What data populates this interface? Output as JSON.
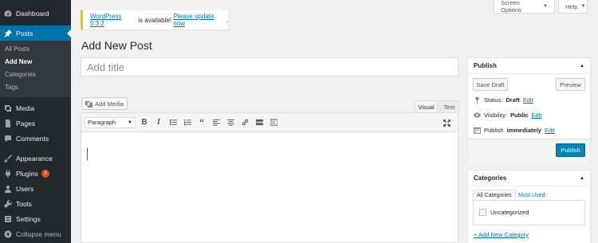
{
  "sidebar": {
    "items": [
      {
        "label": "Dashboard",
        "icon": "dashboard-icon"
      },
      {
        "label": "Posts",
        "icon": "pin-icon"
      },
      {
        "label": "Media",
        "icon": "media-icon"
      },
      {
        "label": "Pages",
        "icon": "page-icon"
      },
      {
        "label": "Comments",
        "icon": "comment-icon"
      },
      {
        "label": "Appearance",
        "icon": "brush-icon"
      },
      {
        "label": "Plugins",
        "icon": "plug-icon",
        "badge": "1"
      },
      {
        "label": "Users",
        "icon": "user-icon"
      },
      {
        "label": "Tools",
        "icon": "wrench-icon"
      },
      {
        "label": "Settings",
        "icon": "settings-icon"
      }
    ],
    "posts_submenu": [
      "All Posts",
      "Add New",
      "Categories",
      "Tags"
    ],
    "collapse_label": "Collapse menu"
  },
  "top": {
    "screen_options": "Screen Options",
    "help": "Help"
  },
  "notice": {
    "version_link": "WordPress 5.3.2",
    "text": " is available! ",
    "update_link": "Please update now",
    "end": "."
  },
  "page_title": "Add New Post",
  "title_input": {
    "placeholder": "Add title"
  },
  "editor": {
    "add_media": "Add Media",
    "tabs": [
      "Visual",
      "Text"
    ],
    "format": "Paragraph",
    "tools": [
      "bold-icon",
      "italic-icon",
      "bullet-list-icon",
      "numbered-list-icon",
      "blockquote-icon",
      "align-left-icon",
      "align-center-icon",
      "link-icon",
      "read-more-icon",
      "toolbar-toggle-icon",
      "fullscreen-icon"
    ]
  },
  "publish": {
    "title": "Publish",
    "save_draft": "Save Draft",
    "preview": "Preview",
    "status_label": "Status:",
    "status_value": "Draft",
    "visibility_label": "Visibility:",
    "visibility_value": "Public",
    "publish_label": "Publish",
    "publish_value": "immediately",
    "edit": "Edit",
    "publish_button": "Publish"
  },
  "categories": {
    "title": "Categories",
    "tabs": [
      "All Categories",
      "Most Used"
    ],
    "items": [
      "Uncategorized"
    ],
    "add_new": "+ Add New Category"
  },
  "colors": {
    "accent": "#0073aa",
    "sidebar": "#23282d",
    "notice": "#ffb900",
    "primary_button": "#0085ba",
    "badge": "#d54e21"
  }
}
